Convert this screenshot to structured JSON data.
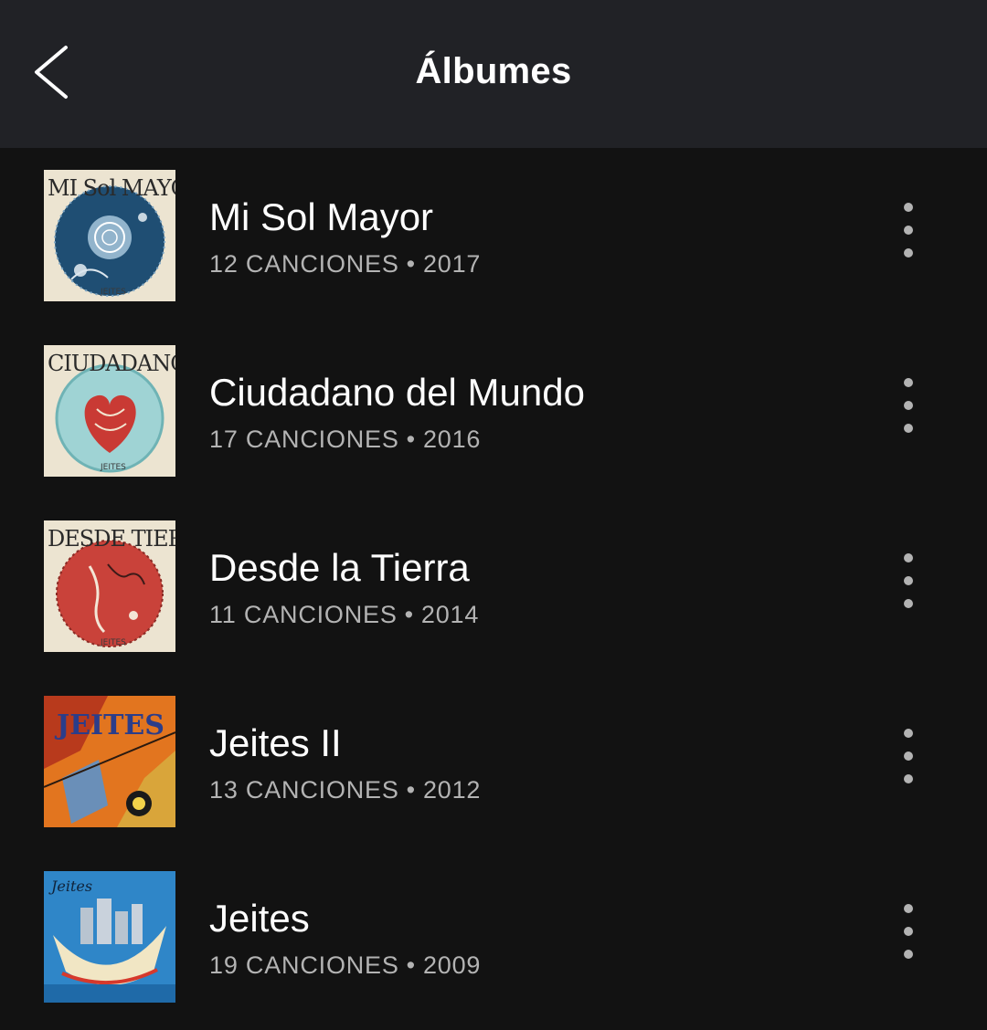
{
  "header": {
    "title": "Álbumes",
    "back_icon": "chevron-left-icon"
  },
  "albums": [
    {
      "title": "Mi Sol Mayor",
      "songs": "12 CANCIONES",
      "year": "2017",
      "cover_label": "MI Sol MAYOR",
      "cover_footer": "JEITES",
      "more_icon": "more-vertical-icon"
    },
    {
      "title": "Ciudadano del Mundo",
      "songs": "17 CANCIONES",
      "year": "2016",
      "cover_label": "CIUDADANO MUNDO",
      "cover_footer": "JEITES",
      "more_icon": "more-vertical-icon"
    },
    {
      "title": "Desde la Tierra",
      "songs": "11 CANCIONES",
      "year": "2014",
      "cover_label": "DESDE TIERRA",
      "cover_footer": "JEITES",
      "more_icon": "more-vertical-icon"
    },
    {
      "title": "Jeites II",
      "songs": "13 CANCIONES",
      "year": "2012",
      "cover_label": "JEITES",
      "cover_footer": "",
      "more_icon": "more-vertical-icon"
    },
    {
      "title": "Jeites",
      "songs": "19 CANCIONES",
      "year": "2009",
      "cover_label": "Jeites",
      "cover_footer": "",
      "more_icon": "more-vertical-icon"
    }
  ],
  "separator": "•",
  "colors": {
    "background": "#121212",
    "header_bg": "#212226",
    "text_primary": "#ffffff",
    "text_secondary": "#b3b3b3"
  }
}
